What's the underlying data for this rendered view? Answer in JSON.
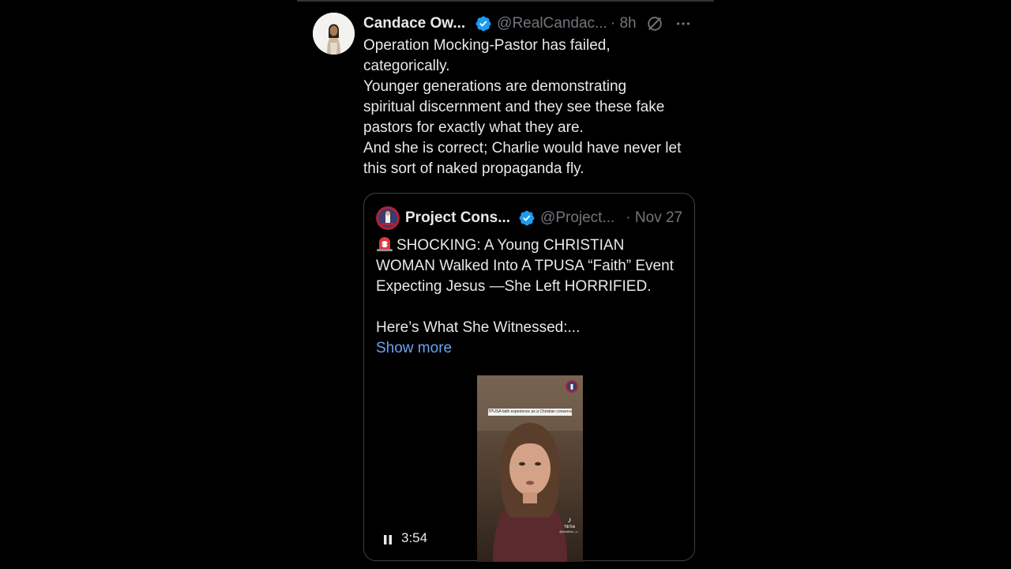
{
  "post": {
    "author_name": "Candace Ow...",
    "handle": "@RealCandac...",
    "separator_time": "· 8h",
    "verified_color": "#1d9bf0",
    "text_lines": [
      "Operation Mocking-Pastor has failed,",
      "categorically.",
      "Younger generations are demonstrating",
      "spiritual discernment and they see these fake",
      "pastors for exactly what they are.",
      "And she is correct; Charlie would have never let",
      "this sort of naked propaganda fly."
    ],
    "icons": [
      "verified-badge-icon",
      "grok-icon",
      "more-options-icon"
    ]
  },
  "quote": {
    "author_name": "Project Cons...",
    "handle": "@Project...",
    "date": "· Nov 27",
    "text_line_1": "SHOCKING: A Young CHRISTIAN",
    "text_line_2": "WOMAN Walked Into A TPUSA “Faith” Event",
    "text_line_3": "Expecting Jesus —She Left HORRIFIED.",
    "text_line_4": "Here’s What She Witnessed:...",
    "show_more": "Show more",
    "link_color": "#6aa3f0",
    "icons": [
      "siren-emoji-icon",
      "verified-badge-icon"
    ],
    "video": {
      "caption": "TPUSA faith experience as a Christian conservative",
      "watermark_label": "TikTok",
      "watermark_user": "@beatrice_c...",
      "duration": "3:54",
      "state_icon": "pause-icon"
    }
  }
}
